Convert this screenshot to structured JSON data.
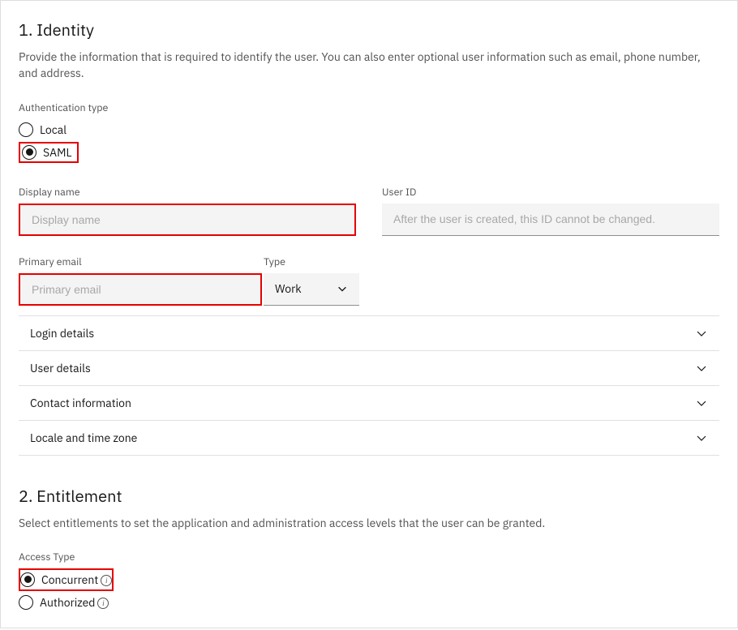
{
  "identity": {
    "title": "1. Identity",
    "description": "Provide the information that is required to identify the user. You can also enter optional user information such as email, phone number, and address.",
    "auth_type_label": "Authentication type",
    "auth_options": {
      "local": "Local",
      "saml": "SAML"
    },
    "display_name": {
      "label": "Display name",
      "placeholder": "Display name"
    },
    "user_id": {
      "label": "User ID",
      "placeholder": "After the user is created, this ID cannot be changed."
    },
    "primary_email": {
      "label": "Primary email",
      "placeholder": "Primary email"
    },
    "email_type": {
      "label": "Type",
      "value": "Work"
    },
    "accordion": {
      "login_details": "Login details",
      "user_details": "User details",
      "contact_info": "Contact information",
      "locale": "Locale and time zone"
    }
  },
  "entitlement": {
    "title": "2. Entitlement",
    "description": "Select entitlements to set the application and administration access levels that the user can be granted.",
    "access_type_label": "Access Type",
    "access_options": {
      "concurrent": "Concurrent",
      "authorized": "Authorized"
    }
  }
}
